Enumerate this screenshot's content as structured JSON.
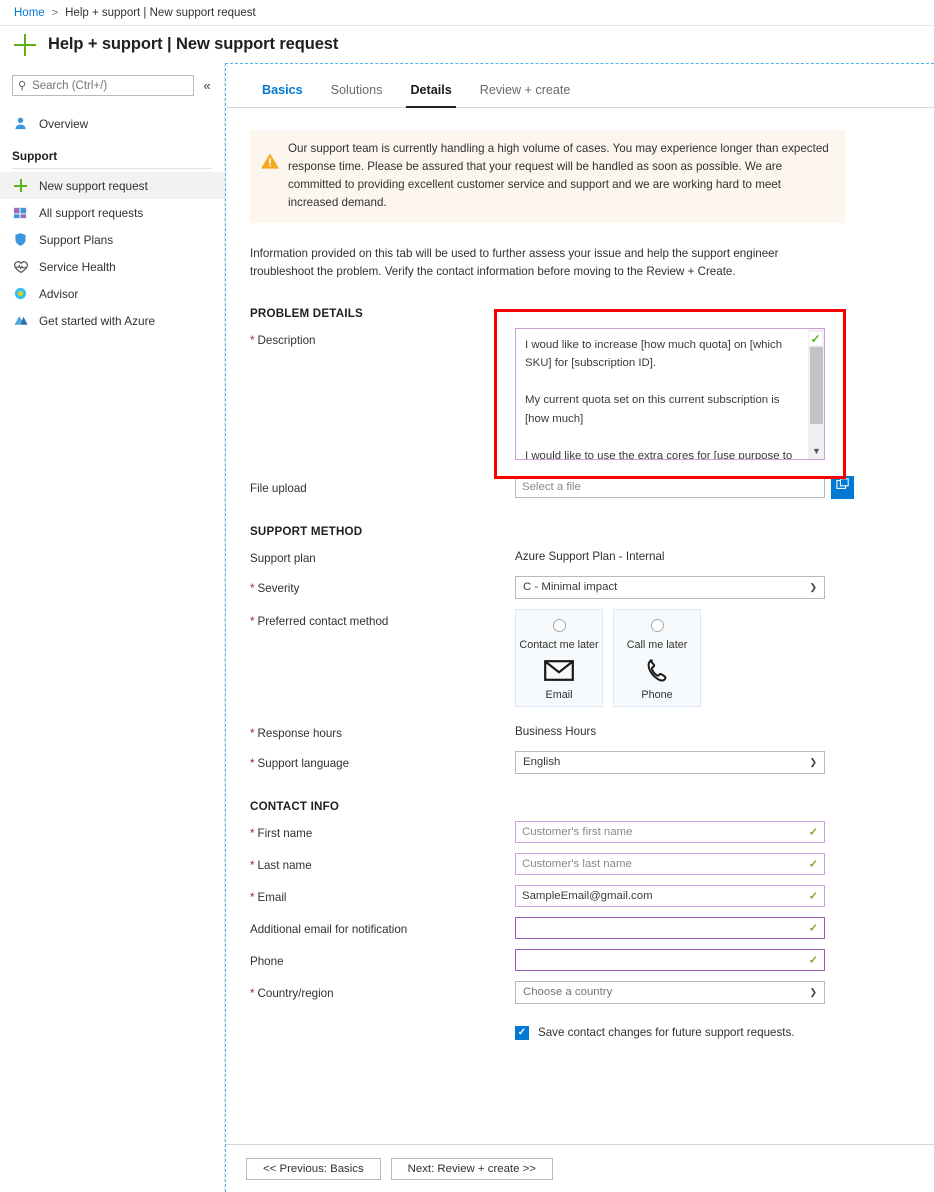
{
  "breadcrumb": {
    "home": "Home",
    "separator": ">",
    "current": "Help + support | New support request"
  },
  "header": {
    "title": "Help + support | New support request",
    "icon": "plus-icon"
  },
  "sidebar": {
    "search_placeholder": "Search (Ctrl+/)",
    "collapse_glyph": "«",
    "overview": {
      "label": "Overview",
      "icon": "person-icon"
    },
    "section_label": "Support",
    "items": [
      {
        "label": "New support request",
        "icon": "plus-icon",
        "active": true
      },
      {
        "label": "All support requests",
        "icon": "requests-icon",
        "active": false
      },
      {
        "label": "Support Plans",
        "icon": "shield-icon",
        "active": false
      },
      {
        "label": "Service Health",
        "icon": "heartbeat-icon",
        "active": false
      },
      {
        "label": "Advisor",
        "icon": "advisor-icon",
        "active": false
      },
      {
        "label": "Get started with Azure",
        "icon": "azure-icon",
        "active": false
      }
    ]
  },
  "tabs": [
    {
      "label": "Basics",
      "state": "link"
    },
    {
      "label": "Solutions",
      "state": "normal"
    },
    {
      "label": "Details",
      "state": "active"
    },
    {
      "label": "Review + create",
      "state": "normal"
    }
  ],
  "banner": {
    "icon": "warning-icon",
    "text": "Our support team is currently handling a high volume of cases. You may experience longer than expected response time. Please be assured that your request will be handled as soon as possible. We are committed to providing excellent customer service and support and we are working hard to meet increased demand."
  },
  "intro_text": "Information provided on this tab will be used to further assess your issue and help the support engineer troubleshoot the problem. Verify the contact information before moving to the Review + Create.",
  "problem_details": {
    "section_title": "PROBLEM DETAILS",
    "description": {
      "label": "Description",
      "required": true,
      "value": "I woud like to increase [how much quota] on [which SKU] for [subscription ID].\n\nMy current quota set on this current subscription is [how much]\n\nI would like to use the extra cores for [use purpose to call out why the extra cores are important]",
      "valid_check": "✓",
      "scroll_down_glyph": "▼",
      "highlighted": true,
      "highlight_color": "#f60000"
    },
    "file_upload": {
      "label": "File upload",
      "required": false,
      "placeholder": "Select a file",
      "value": "",
      "browse_icon": "folder-browse-icon",
      "browse_color": "#0078d4"
    }
  },
  "support_method": {
    "section_title": "SUPPORT METHOD",
    "support_plan": {
      "label": "Support plan",
      "required": false,
      "value": "Azure Support Plan - Internal"
    },
    "severity": {
      "label": "Severity",
      "required": true,
      "value": "C - Minimal impact"
    },
    "preferred_contact_method": {
      "label": "Preferred contact method",
      "required": true,
      "options": [
        {
          "top_label": "Contact me later",
          "bottom_label": "Email",
          "icon": "envelope-icon",
          "selected": false
        },
        {
          "top_label": "Call me later",
          "bottom_label": "Phone",
          "icon": "phone-icon",
          "selected": false
        }
      ]
    },
    "response_hours": {
      "label": "Response hours",
      "required": true,
      "value": "Business Hours"
    },
    "support_language": {
      "label": "Support language",
      "required": true,
      "value": "English"
    }
  },
  "contact_info": {
    "section_title": "CONTACT INFO",
    "fields": [
      {
        "label": "First name",
        "required": true,
        "value": "Customer's first name",
        "is_placeholder": false,
        "valid": true,
        "type": "text"
      },
      {
        "label": "Last name",
        "required": true,
        "value": "Customer's last name",
        "is_placeholder": false,
        "valid": true,
        "type": "text"
      },
      {
        "label": "Email",
        "required": true,
        "value": "SampleEmail@gmail.com",
        "is_placeholder": false,
        "valid": true,
        "type": "text"
      },
      {
        "label": "Additional email for notification",
        "required": false,
        "value": "",
        "is_placeholder": false,
        "valid": true,
        "type": "text"
      },
      {
        "label": "Phone",
        "required": false,
        "value": "",
        "is_placeholder": false,
        "valid": true,
        "type": "text"
      }
    ],
    "country": {
      "label": "Country/region",
      "required": true,
      "value": "Choose a country",
      "is_placeholder": true
    },
    "save_contact": {
      "label": "Save contact changes for future support requests.",
      "checked": true,
      "color": "#0078d4"
    }
  },
  "footer": {
    "previous": "<< Previous: Basics",
    "next": "Next: Review + create >>"
  }
}
